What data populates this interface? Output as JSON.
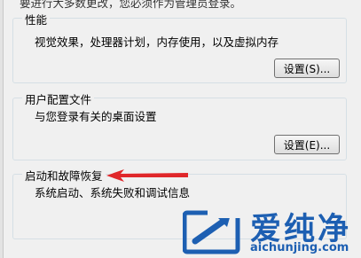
{
  "header": {
    "truncated_text": "要进行大多数更改，您必须作为管理员登录。"
  },
  "performance": {
    "title": "性能",
    "description": "视觉效果，处理器计划，内存使用，以及虚拟内存",
    "button": "设置(S)..."
  },
  "user_profiles": {
    "title": "用户配置文件",
    "description": "与您登录有关的桌面设置",
    "button": "设置(E)..."
  },
  "startup_recovery": {
    "title": "启动和故障恢复",
    "description": "系统启动、系统失败和调试信息"
  },
  "watermark": {
    "title": "爱纯净",
    "url": "aichunjing.com"
  },
  "colors": {
    "arrow": "#e0272a",
    "watermark": "#1d5fb2"
  }
}
